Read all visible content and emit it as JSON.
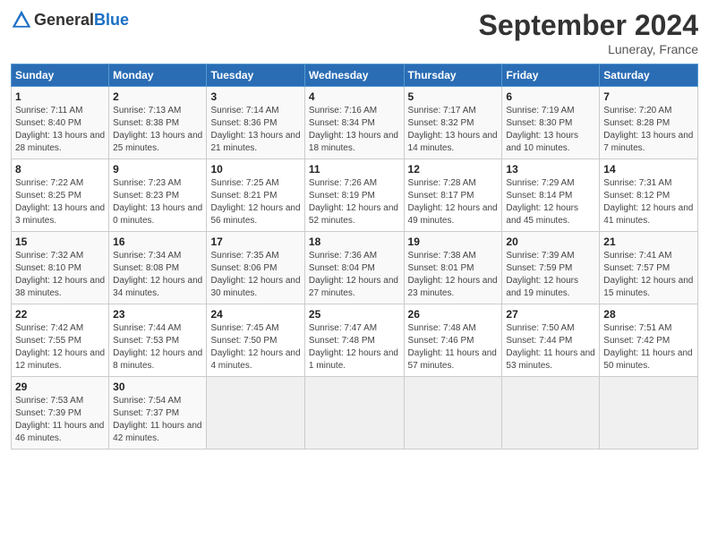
{
  "header": {
    "logo_general": "General",
    "logo_blue": "Blue",
    "month_title": "September 2024",
    "location": "Luneray, France"
  },
  "days_of_week": [
    "Sunday",
    "Monday",
    "Tuesday",
    "Wednesday",
    "Thursday",
    "Friday",
    "Saturday"
  ],
  "weeks": [
    [
      {
        "day": "1",
        "sunrise": "7:11 AM",
        "sunset": "8:40 PM",
        "daylight": "13 hours and 28 minutes."
      },
      {
        "day": "2",
        "sunrise": "7:13 AM",
        "sunset": "8:38 PM",
        "daylight": "13 hours and 25 minutes."
      },
      {
        "day": "3",
        "sunrise": "7:14 AM",
        "sunset": "8:36 PM",
        "daylight": "13 hours and 21 minutes."
      },
      {
        "day": "4",
        "sunrise": "7:16 AM",
        "sunset": "8:34 PM",
        "daylight": "13 hours and 18 minutes."
      },
      {
        "day": "5",
        "sunrise": "7:17 AM",
        "sunset": "8:32 PM",
        "daylight": "13 hours and 14 minutes."
      },
      {
        "day": "6",
        "sunrise": "7:19 AM",
        "sunset": "8:30 PM",
        "daylight": "13 hours and 10 minutes."
      },
      {
        "day": "7",
        "sunrise": "7:20 AM",
        "sunset": "8:28 PM",
        "daylight": "13 hours and 7 minutes."
      }
    ],
    [
      {
        "day": "8",
        "sunrise": "7:22 AM",
        "sunset": "8:25 PM",
        "daylight": "13 hours and 3 minutes."
      },
      {
        "day": "9",
        "sunrise": "7:23 AM",
        "sunset": "8:23 PM",
        "daylight": "13 hours and 0 minutes."
      },
      {
        "day": "10",
        "sunrise": "7:25 AM",
        "sunset": "8:21 PM",
        "daylight": "12 hours and 56 minutes."
      },
      {
        "day": "11",
        "sunrise": "7:26 AM",
        "sunset": "8:19 PM",
        "daylight": "12 hours and 52 minutes."
      },
      {
        "day": "12",
        "sunrise": "7:28 AM",
        "sunset": "8:17 PM",
        "daylight": "12 hours and 49 minutes."
      },
      {
        "day": "13",
        "sunrise": "7:29 AM",
        "sunset": "8:14 PM",
        "daylight": "12 hours and 45 minutes."
      },
      {
        "day": "14",
        "sunrise": "7:31 AM",
        "sunset": "8:12 PM",
        "daylight": "12 hours and 41 minutes."
      }
    ],
    [
      {
        "day": "15",
        "sunrise": "7:32 AM",
        "sunset": "8:10 PM",
        "daylight": "12 hours and 38 minutes."
      },
      {
        "day": "16",
        "sunrise": "7:34 AM",
        "sunset": "8:08 PM",
        "daylight": "12 hours and 34 minutes."
      },
      {
        "day": "17",
        "sunrise": "7:35 AM",
        "sunset": "8:06 PM",
        "daylight": "12 hours and 30 minutes."
      },
      {
        "day": "18",
        "sunrise": "7:36 AM",
        "sunset": "8:04 PM",
        "daylight": "12 hours and 27 minutes."
      },
      {
        "day": "19",
        "sunrise": "7:38 AM",
        "sunset": "8:01 PM",
        "daylight": "12 hours and 23 minutes."
      },
      {
        "day": "20",
        "sunrise": "7:39 AM",
        "sunset": "7:59 PM",
        "daylight": "12 hours and 19 minutes."
      },
      {
        "day": "21",
        "sunrise": "7:41 AM",
        "sunset": "7:57 PM",
        "daylight": "12 hours and 15 minutes."
      }
    ],
    [
      {
        "day": "22",
        "sunrise": "7:42 AM",
        "sunset": "7:55 PM",
        "daylight": "12 hours and 12 minutes."
      },
      {
        "day": "23",
        "sunrise": "7:44 AM",
        "sunset": "7:53 PM",
        "daylight": "12 hours and 8 minutes."
      },
      {
        "day": "24",
        "sunrise": "7:45 AM",
        "sunset": "7:50 PM",
        "daylight": "12 hours and 4 minutes."
      },
      {
        "day": "25",
        "sunrise": "7:47 AM",
        "sunset": "7:48 PM",
        "daylight": "12 hours and 1 minute."
      },
      {
        "day": "26",
        "sunrise": "7:48 AM",
        "sunset": "7:46 PM",
        "daylight": "11 hours and 57 minutes."
      },
      {
        "day": "27",
        "sunrise": "7:50 AM",
        "sunset": "7:44 PM",
        "daylight": "11 hours and 53 minutes."
      },
      {
        "day": "28",
        "sunrise": "7:51 AM",
        "sunset": "7:42 PM",
        "daylight": "11 hours and 50 minutes."
      }
    ],
    [
      {
        "day": "29",
        "sunrise": "7:53 AM",
        "sunset": "7:39 PM",
        "daylight": "11 hours and 46 minutes."
      },
      {
        "day": "30",
        "sunrise": "7:54 AM",
        "sunset": "7:37 PM",
        "daylight": "11 hours and 42 minutes."
      },
      null,
      null,
      null,
      null,
      null
    ]
  ]
}
